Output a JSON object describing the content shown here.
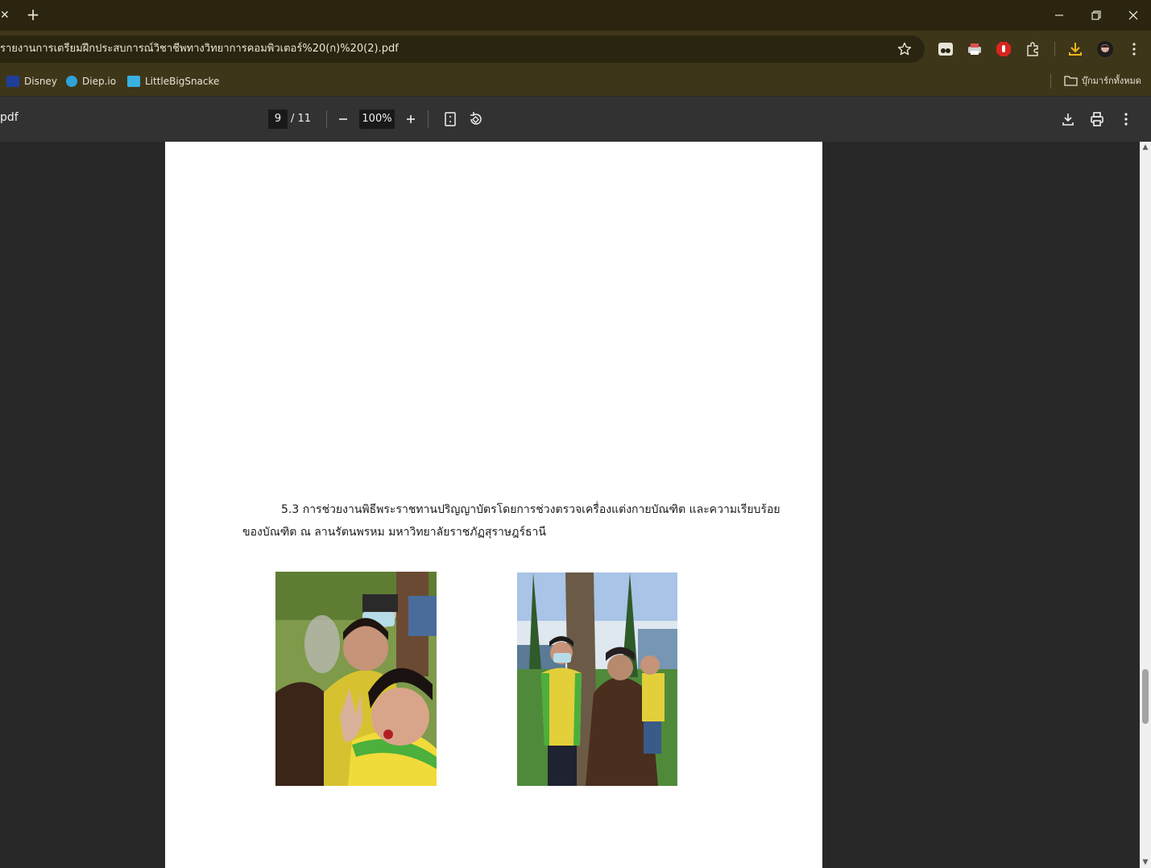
{
  "tabbar": {
    "close_glyph": "✕",
    "new_tab_glyph": "+",
    "minimize_glyph": "—",
    "restore_glyph": "❐",
    "close_window_glyph": "✕"
  },
  "omnibox": {
    "url": "รายงานการเตรียมฝึกประสบการณ์วิชาชีพทางวิทยาการคอมพิวเตอร์%20(ก)%20(2).pdf"
  },
  "bookmarks": {
    "items": [
      {
        "label": "Disney",
        "icon": "disney-icon",
        "color": "#1f3e9a"
      },
      {
        "label": "Diep.io",
        "icon": "diep-icon",
        "color": "#2fa3d9"
      },
      {
        "label": "LittleBigSnacke",
        "icon": "littlebigsnake-icon",
        "color": "#3ab0e0"
      }
    ],
    "all_bookmarks": "บุ๊กมาร์กทั้งหมด"
  },
  "pdf_toolbar": {
    "title": "pdf",
    "current_page": "9",
    "total_pages": "/ 11",
    "zoom": "100%"
  },
  "document": {
    "caption_line1": "5.3 การช่วยงานพิธีพระราชทานปริญญาบัตรโดยการช่วงตรวจเครื่องแต่งกายบัณฑิต และความเรียบร้อย",
    "caption_line2": "ของบัณฑิต ณ ลานรัตนพรหม มหาวิทยาลัยราชภัฏสุราษฎร์ธานี"
  }
}
